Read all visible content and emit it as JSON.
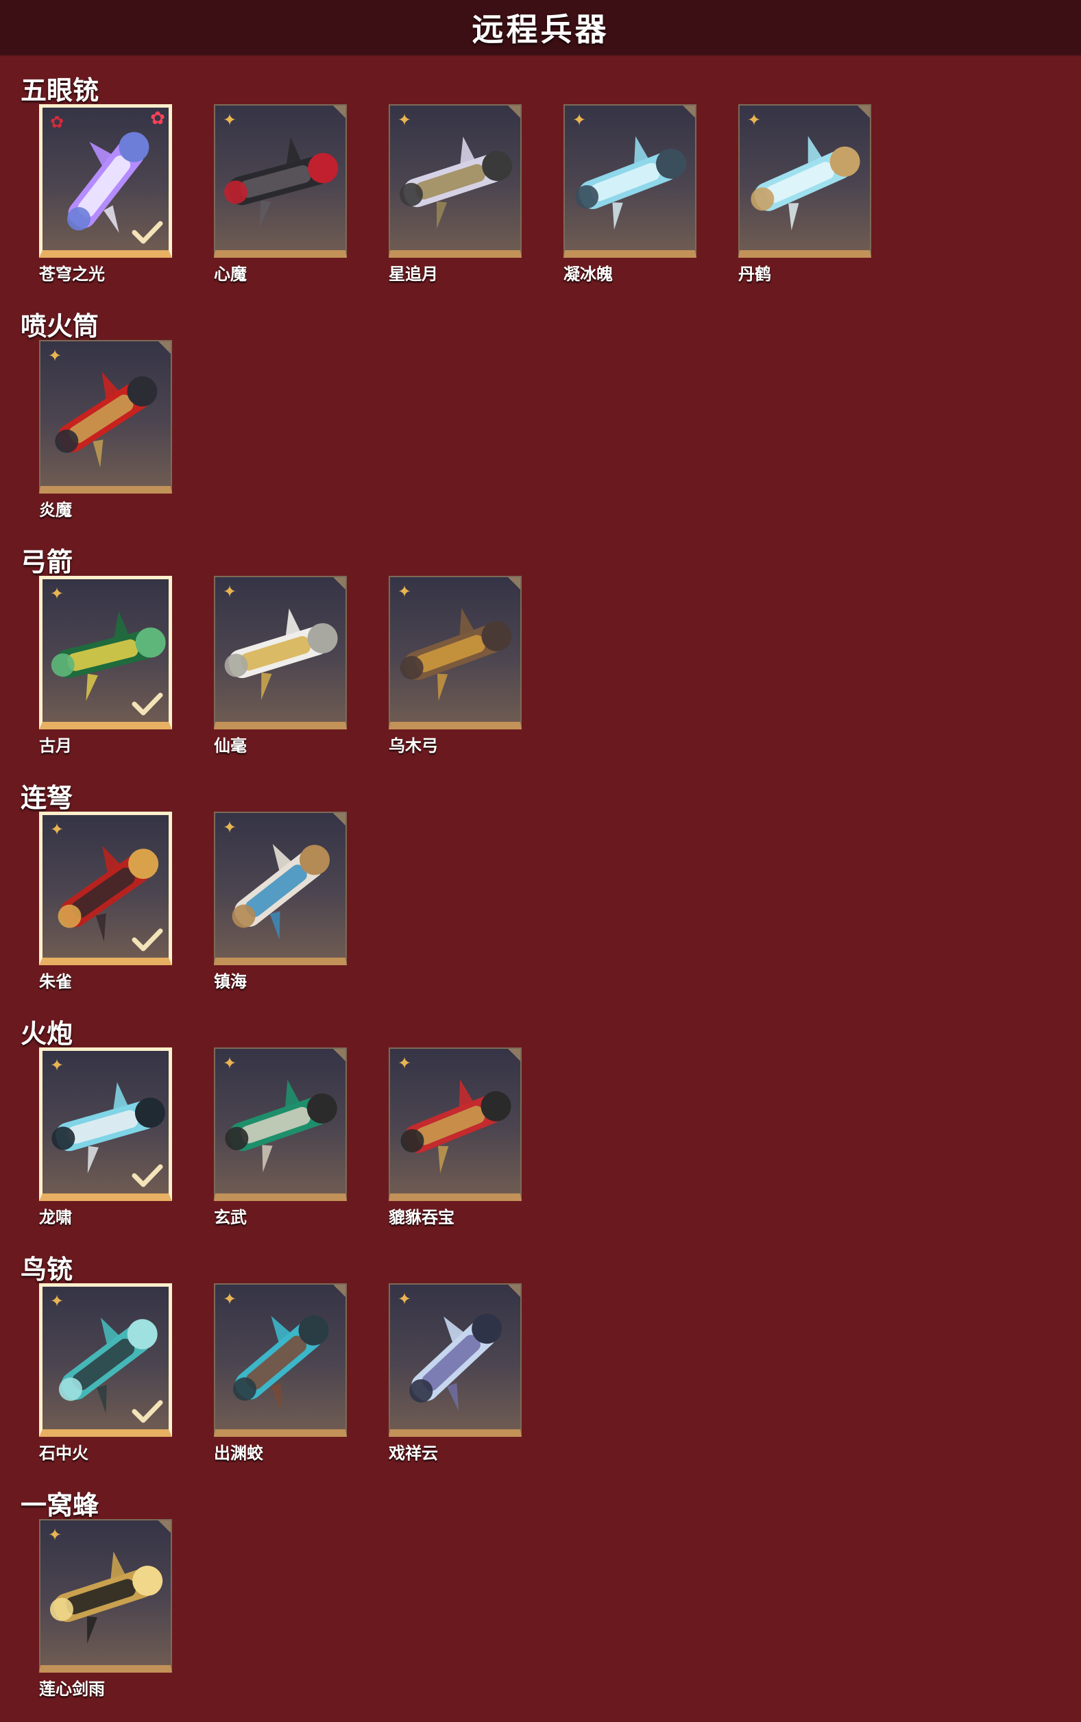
{
  "page": {
    "title": "远程兵器"
  },
  "colors": {
    "background": "#6a1a1f",
    "titlebar": "#3b0f13",
    "card_border": "#c39258",
    "selected_border": "#fff0cc",
    "rank_gold": "#e9b552",
    "rank_red": "#d52a3a"
  },
  "sections": [
    {
      "title": "五眼铳",
      "items": [
        {
          "name": "苍穹之光",
          "selected": true,
          "rank": "red",
          "new": true,
          "palette": [
            "#b58cff",
            "#f2f0ff",
            "#6c7ed8"
          ]
        },
        {
          "name": "心魔",
          "selected": false,
          "rank": "gold",
          "new": false,
          "palette": [
            "#2a2a2e",
            "#5f5b60",
            "#c1202f"
          ]
        },
        {
          "name": "星追月",
          "selected": false,
          "rank": "gold",
          "new": false,
          "palette": [
            "#d6d2e6",
            "#9e8a55",
            "#3b3a3a"
          ]
        },
        {
          "name": "凝冰魄",
          "selected": false,
          "rank": "gold",
          "new": false,
          "palette": [
            "#8fd7ea",
            "#dff6fb",
            "#3a4e5c"
          ]
        },
        {
          "name": "丹鹤",
          "selected": false,
          "rank": "gold",
          "new": false,
          "palette": [
            "#9fe0ef",
            "#e8f7fb",
            "#c7a267"
          ]
        }
      ]
    },
    {
      "title": "喷火筒",
      "items": [
        {
          "name": "炎魔",
          "selected": false,
          "rank": "gold",
          "new": false,
          "palette": [
            "#c8221f",
            "#c8a252",
            "#2c2c34"
          ]
        }
      ]
    },
    {
      "title": "弓箭",
      "items": [
        {
          "name": "古月",
          "selected": true,
          "rank": "gold",
          "new": false,
          "palette": [
            "#1f6b3d",
            "#e6d24a",
            "#5fb67a"
          ]
        },
        {
          "name": "仙毫",
          "selected": false,
          "rank": "gold",
          "new": false,
          "palette": [
            "#efeeea",
            "#d7b04d",
            "#a8a8a0"
          ]
        },
        {
          "name": "乌木弓",
          "selected": false,
          "rank": "gold",
          "new": false,
          "palette": [
            "#7b5a3d",
            "#d09b3c",
            "#4a3a36"
          ]
        }
      ]
    },
    {
      "title": "连弩",
      "items": [
        {
          "name": "朱雀",
          "selected": true,
          "rank": "gold",
          "new": false,
          "palette": [
            "#b8221e",
            "#35272a",
            "#d9a24a"
          ]
        },
        {
          "name": "镇海",
          "selected": false,
          "rank": "gold",
          "new": false,
          "palette": [
            "#e6e0d6",
            "#3a8fbf",
            "#b48a55"
          ]
        }
      ]
    },
    {
      "title": "火炮",
      "items": [
        {
          "name": "龙啸",
          "selected": true,
          "rank": "gold",
          "new": false,
          "palette": [
            "#7fd4e6",
            "#e9eef2",
            "#1f2a33"
          ]
        },
        {
          "name": "玄武",
          "selected": false,
          "rank": "gold",
          "new": false,
          "palette": [
            "#1e8f6b",
            "#d9d2c2",
            "#2b2b2b"
          ]
        },
        {
          "name": "貔貅吞宝",
          "selected": false,
          "rank": "gold",
          "new": false,
          "palette": [
            "#c42a2e",
            "#c9a04e",
            "#2a2a2a"
          ]
        }
      ]
    },
    {
      "title": "鸟铳",
      "items": [
        {
          "name": "石中火",
          "selected": true,
          "rank": "gold",
          "new": false,
          "palette": [
            "#46b7b7",
            "#2b3c3f",
            "#9fe0e0"
          ]
        },
        {
          "name": "出渊蛟",
          "selected": false,
          "rank": "gold",
          "new": false,
          "palette": [
            "#3cb6c9",
            "#7a4a35",
            "#2a3c44"
          ]
        },
        {
          "name": "戏祥云",
          "selected": false,
          "rank": "gold",
          "new": false,
          "palette": [
            "#c7d6ef",
            "#6f6fa8",
            "#2f3347"
          ]
        }
      ]
    },
    {
      "title": "一窝蜂",
      "items": [
        {
          "name": "莲心剑雨",
          "selected": false,
          "rank": "gold",
          "new": false,
          "palette": [
            "#c9a14f",
            "#1f1f1f",
            "#f0d78a"
          ]
        }
      ]
    }
  ]
}
